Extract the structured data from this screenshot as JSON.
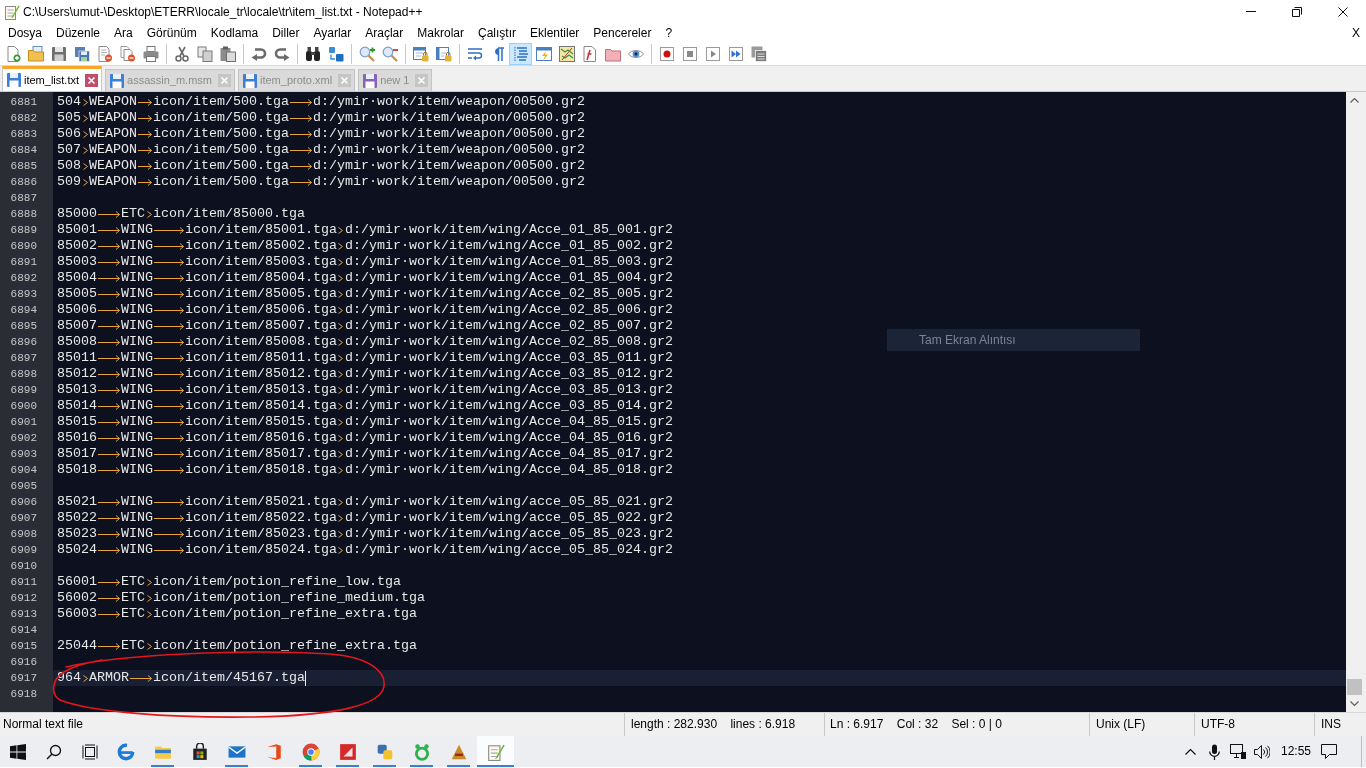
{
  "window": {
    "title": "C:\\Users\\umut-\\Desktop\\ETERR\\locale_tr\\locale\\tr\\item_list.txt - Notepad++"
  },
  "menu_bar": {
    "items": [
      "Dosya",
      "Düzenle",
      "Ara",
      "Görünüm",
      "Kodlama",
      "Diller",
      "Ayarlar",
      "Araçlar",
      "Makrolar",
      "Çalıştır",
      "Eklentiler",
      "Pencereler",
      "?"
    ],
    "close": "X"
  },
  "toolbar": [
    [
      {
        "kind": "new",
        "pressed": false
      },
      {
        "kind": "open",
        "pressed": false
      },
      {
        "kind": "save",
        "pressed": false
      },
      {
        "kind": "saveall",
        "pressed": false
      },
      {
        "kind": "close",
        "pressed": false
      },
      {
        "kind": "closeall",
        "pressed": false
      },
      {
        "kind": "print",
        "pressed": false
      }
    ],
    [
      {
        "kind": "cut",
        "pressed": false
      },
      {
        "kind": "copy",
        "pressed": false
      },
      {
        "kind": "paste",
        "pressed": false
      }
    ],
    [
      {
        "kind": "undo",
        "pressed": false
      },
      {
        "kind": "redo",
        "pressed": false
      }
    ],
    [
      {
        "kind": "find",
        "pressed": false
      },
      {
        "kind": "replace",
        "pressed": false
      }
    ],
    [
      {
        "kind": "zoomin",
        "pressed": false
      },
      {
        "kind": "zoomout",
        "pressed": false
      }
    ],
    [
      {
        "kind": "syncv",
        "pressed": false
      },
      {
        "kind": "synch",
        "pressed": false
      }
    ],
    [
      {
        "kind": "wrap",
        "pressed": false
      },
      {
        "kind": "allchars",
        "pressed": false
      },
      {
        "kind": "indent",
        "pressed": true
      },
      {
        "kind": "udl",
        "pressed": false
      },
      {
        "kind": "docmap",
        "pressed": false
      },
      {
        "kind": "funclist",
        "pressed": false
      },
      {
        "kind": "workspace",
        "pressed": false
      },
      {
        "kind": "monitor",
        "pressed": false
      }
    ],
    [
      {
        "kind": "record",
        "pressed": false
      },
      {
        "kind": "stop",
        "pressed": false
      },
      {
        "kind": "play",
        "pressed": false
      },
      {
        "kind": "playmulti",
        "pressed": false
      },
      {
        "kind": "savemacro",
        "pressed": false
      }
    ]
  ],
  "tabs": [
    {
      "label": "item_list.txt",
      "selected": true,
      "color": "#3d7ed6"
    },
    {
      "label": "assassin_m.msm",
      "selected": false,
      "color": "#3d7ed6"
    },
    {
      "label": "item_proto.xml",
      "selected": false,
      "color": "#3d7ed6"
    },
    {
      "label": "new 1",
      "selected": false,
      "color": "#8a63b8"
    }
  ],
  "editor": {
    "lines": [
      {
        "number": "6881",
        "current": false,
        "fields": [
          "504",
          "WEAPON",
          "icon/item/500.tga",
          "d:/ymir·work/item/weapon/00500.gr2"
        ]
      },
      {
        "number": "6882",
        "current": false,
        "fields": [
          "505",
          "WEAPON",
          "icon/item/500.tga",
          "d:/ymir·work/item/weapon/00500.gr2"
        ]
      },
      {
        "number": "6883",
        "current": false,
        "fields": [
          "506",
          "WEAPON",
          "icon/item/500.tga",
          "d:/ymir·work/item/weapon/00500.gr2"
        ]
      },
      {
        "number": "6884",
        "current": false,
        "fields": [
          "507",
          "WEAPON",
          "icon/item/500.tga",
          "d:/ymir·work/item/weapon/00500.gr2"
        ]
      },
      {
        "number": "6885",
        "current": false,
        "fields": [
          "508",
          "WEAPON",
          "icon/item/500.tga",
          "d:/ymir·work/item/weapon/00500.gr2"
        ]
      },
      {
        "number": "6886",
        "current": false,
        "fields": [
          "509",
          "WEAPON",
          "icon/item/500.tga",
          "d:/ymir·work/item/weapon/00500.gr2"
        ]
      },
      {
        "number": "6887",
        "current": false
      },
      {
        "number": "6888",
        "current": false,
        "fields": [
          "85000",
          "ETC",
          "icon/item/85000.tga"
        ]
      },
      {
        "number": "6889",
        "current": false,
        "fields": [
          "85001",
          "WING",
          "icon/item/85001.tga",
          "d:/ymir·work/item/wing/Acce_01_85_001.gr2"
        ]
      },
      {
        "number": "6890",
        "current": false,
        "fields": [
          "85002",
          "WING",
          "icon/item/85002.tga",
          "d:/ymir·work/item/wing/Acce_01_85_002.gr2"
        ]
      },
      {
        "number": "6891",
        "current": false,
        "fields": [
          "85003",
          "WING",
          "icon/item/85003.tga",
          "d:/ymir·work/item/wing/Acce_01_85_003.gr2"
        ]
      },
      {
        "number": "6892",
        "current": false,
        "fields": [
          "85004",
          "WING",
          "icon/item/85004.tga",
          "d:/ymir·work/item/wing/Acce_01_85_004.gr2"
        ]
      },
      {
        "number": "6893",
        "current": false,
        "fields": [
          "85005",
          "WING",
          "icon/item/85005.tga",
          "d:/ymir·work/item/wing/Acce_02_85_005.gr2"
        ]
      },
      {
        "number": "6894",
        "current": false,
        "fields": [
          "85006",
          "WING",
          "icon/item/85006.tga",
          "d:/ymir·work/item/wing/Acce_02_85_006.gr2"
        ]
      },
      {
        "number": "6895",
        "current": false,
        "fields": [
          "85007",
          "WING",
          "icon/item/85007.tga",
          "d:/ymir·work/item/wing/Acce_02_85_007.gr2"
        ]
      },
      {
        "number": "6896",
        "current": false,
        "fields": [
          "85008",
          "WING",
          "icon/item/85008.tga",
          "d:/ymir·work/item/wing/Acce_02_85_008.gr2"
        ]
      },
      {
        "number": "6897",
        "current": false,
        "fields": [
          "85011",
          "WING",
          "icon/item/85011.tga",
          "d:/ymir·work/item/wing/Acce_03_85_011.gr2"
        ]
      },
      {
        "number": "6898",
        "current": false,
        "fields": [
          "85012",
          "WING",
          "icon/item/85012.tga",
          "d:/ymir·work/item/wing/Acce_03_85_012.gr2"
        ]
      },
      {
        "number": "6899",
        "current": false,
        "fields": [
          "85013",
          "WING",
          "icon/item/85013.tga",
          "d:/ymir·work/item/wing/Acce_03_85_013.gr2"
        ]
      },
      {
        "number": "6900",
        "current": false,
        "fields": [
          "85014",
          "WING",
          "icon/item/85014.tga",
          "d:/ymir·work/item/wing/Acce_03_85_014.gr2"
        ]
      },
      {
        "number": "6901",
        "current": false,
        "fields": [
          "85015",
          "WING",
          "icon/item/85015.tga",
          "d:/ymir·work/item/wing/Acce_04_85_015.gr2"
        ]
      },
      {
        "number": "6902",
        "current": false,
        "fields": [
          "85016",
          "WING",
          "icon/item/85016.tga",
          "d:/ymir·work/item/wing/Acce_04_85_016.gr2"
        ]
      },
      {
        "number": "6903",
        "current": false,
        "fields": [
          "85017",
          "WING",
          "icon/item/85017.tga",
          "d:/ymir·work/item/wing/Acce_04_85_017.gr2"
        ]
      },
      {
        "number": "6904",
        "current": false,
        "fields": [
          "85018",
          "WING",
          "icon/item/85018.tga",
          "d:/ymir·work/item/wing/Acce_04_85_018.gr2"
        ]
      },
      {
        "number": "6905",
        "current": false
      },
      {
        "number": "6906",
        "current": false,
        "fields": [
          "85021",
          "WING",
          "icon/item/85021.tga",
          "d:/ymir·work/item/wing/acce_05_85_021.gr2"
        ]
      },
      {
        "number": "6907",
        "current": false,
        "fields": [
          "85022",
          "WING",
          "icon/item/85022.tga",
          "d:/ymir·work/item/wing/acce_05_85_022.gr2"
        ]
      },
      {
        "number": "6908",
        "current": false,
        "fields": [
          "85023",
          "WING",
          "icon/item/85023.tga",
          "d:/ymir·work/item/wing/acce_05_85_023.gr2"
        ]
      },
      {
        "number": "6909",
        "current": false,
        "fields": [
          "85024",
          "WING",
          "icon/item/85024.tga",
          "d:/ymir·work/item/wing/acce_05_85_024.gr2"
        ]
      },
      {
        "number": "6910",
        "current": false
      },
      {
        "number": "6911",
        "current": false,
        "fields": [
          "56001",
          "ETC",
          "icon/item/potion_refine_low.tga"
        ]
      },
      {
        "number": "6912",
        "current": false,
        "fields": [
          "56002",
          "ETC",
          "icon/item/potion_refine_medium.tga"
        ]
      },
      {
        "number": "6913",
        "current": false,
        "fields": [
          "56003",
          "ETC",
          "icon/item/potion_refine_extra.tga"
        ]
      },
      {
        "number": "6914",
        "current": false
      },
      {
        "number": "6915",
        "current": false,
        "fields": [
          "25044",
          "ETC",
          "icon/item/potion_refine_extra.tga"
        ]
      },
      {
        "number": "6916",
        "current": false
      },
      {
        "number": "6917",
        "current": true,
        "fields": [
          "964",
          "ARMOR",
          "icon/item/45167.tga"
        ]
      },
      {
        "number": "6918",
        "current": false
      }
    ]
  },
  "tooltip": {
    "text": "Tam Ekran Alıntısı"
  },
  "status_bar": [
    "Normal text file",
    "length : 282.930    lines : 6.918",
    "Ln : 6.917    Col : 32    Sel : 0 | 0",
    "Unix (LF)",
    "UTF-8",
    "INS"
  ],
  "taskbar": {
    "buttons": [
      {
        "kind": "start",
        "running": false,
        "active": false
      },
      {
        "kind": "search",
        "running": false,
        "active": false
      },
      {
        "kind": "taskview",
        "running": false,
        "active": false
      },
      {
        "kind": "edge",
        "running": false,
        "active": false
      },
      {
        "kind": "explorer",
        "running": true,
        "active": false
      },
      {
        "kind": "store",
        "running": false,
        "active": false
      },
      {
        "kind": "mail",
        "running": true,
        "active": false
      },
      {
        "kind": "office",
        "running": false,
        "active": false
      },
      {
        "kind": "chrome",
        "running": true,
        "active": false
      },
      {
        "kind": "tool",
        "running": true,
        "active": false
      },
      {
        "kind": "puzzle",
        "running": true,
        "active": false
      },
      {
        "kind": "ring",
        "running": true,
        "active": false
      },
      {
        "kind": "game",
        "running": true,
        "active": false
      },
      {
        "kind": "notepad",
        "running": true,
        "active": true
      }
    ],
    "tray": [
      {
        "kind": "chevron"
      },
      {
        "kind": "microphone"
      },
      {
        "kind": "network"
      },
      {
        "kind": "volume"
      },
      {
        "kind": "clock",
        "text": "12:55"
      },
      {
        "kind": "notifications"
      }
    ]
  }
}
